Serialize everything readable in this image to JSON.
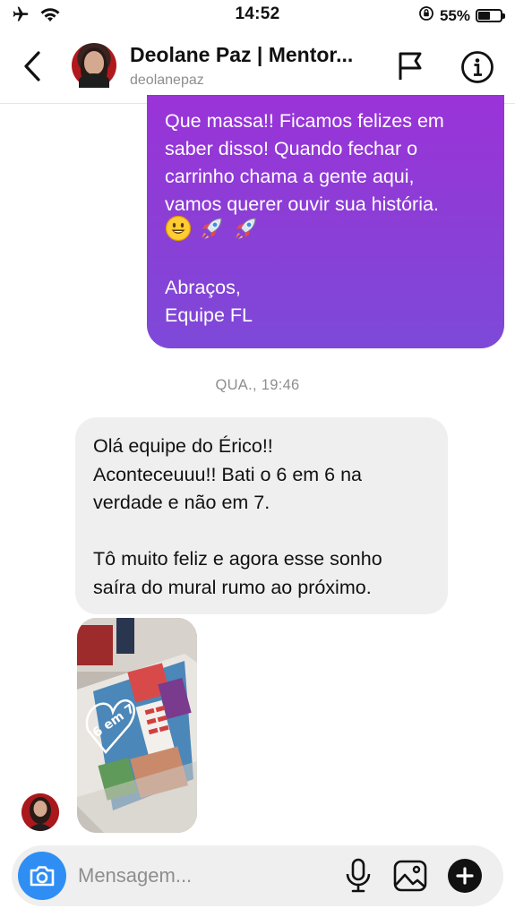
{
  "status_bar": {
    "time": "14:52",
    "battery_percent": "55%",
    "battery_level": 0.55,
    "icons": [
      "airplane-icon",
      "wifi-icon",
      "orientation-lock-icon",
      "battery-icon"
    ]
  },
  "header": {
    "contact_name": "Deolane Paz | Mentor...",
    "username": "deolanepaz",
    "icons": [
      "back-chevron-icon",
      "flag-icon",
      "info-icon"
    ]
  },
  "messages": {
    "outgoing_text": "Que massa!! Ficamos felizes em\nsaber disso! Quando fechar o\ncarrinho chama a gente aqui,\nvamos querer ouvir sua história.",
    "outgoing_emojis": "😃🚀🚀",
    "outgoing_signature": "Abraços,\nEquipe FL",
    "timestamp": "QUA., 19:46",
    "incoming_text": "Olá equipe do Érico!!\nAconteceuuu!! Bati o 6 em 6 na\nverdade e não em 7.\n\nTô muito feliz e agora esse sonho\nsaíra do mural rumo ao próximo.",
    "photo_caption": "6 em 7"
  },
  "composer": {
    "placeholder": "Mensagem...",
    "icons": [
      "camera-icon",
      "microphone-icon",
      "gallery-icon",
      "plus-icon"
    ]
  },
  "colors": {
    "accent_blue": "#2f8ef3",
    "bubble_gradient_top": "#9a33d8",
    "bubble_gradient_bottom": "#7d49d8",
    "incoming_bubble": "#efefef"
  }
}
